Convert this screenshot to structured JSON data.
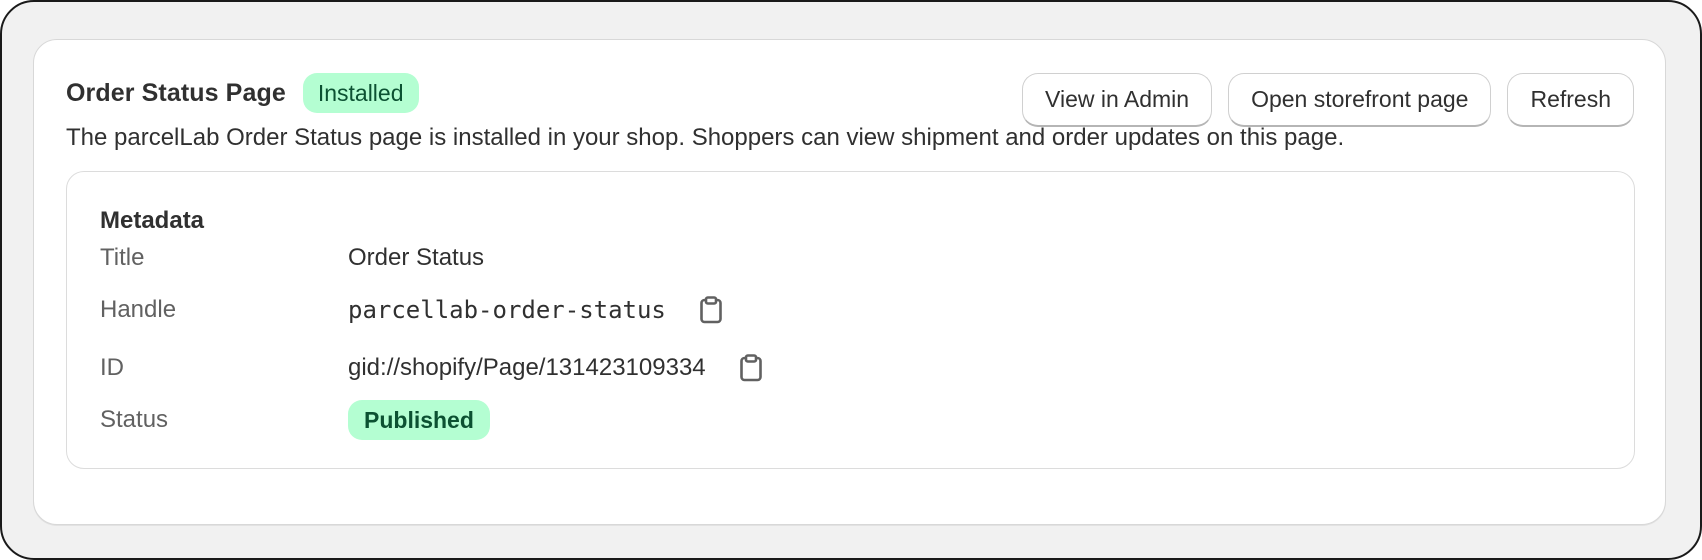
{
  "header": {
    "title": "Order Status Page",
    "badge": "Installed",
    "actions": {
      "view_admin": "View in Admin",
      "open_storefront": "Open storefront page",
      "refresh": "Refresh"
    }
  },
  "description": "The parcelLab Order Status page is installed in your shop. Shoppers can view shipment and order updates on this page.",
  "metadata": {
    "heading": "Metadata",
    "rows": [
      {
        "label": "Title",
        "value": "Order Status"
      },
      {
        "label": "Handle",
        "value": "parcellab-order-status"
      },
      {
        "label": "ID",
        "value": "gid://shopify/Page/131423109334"
      },
      {
        "label": "Status",
        "value": "Published"
      }
    ]
  },
  "icons": {
    "copy": "clipboard-icon"
  },
  "colors": {
    "badge_bg": "#b4fed2",
    "badge_text": "#0c5132",
    "text": "#303030",
    "label": "#616161"
  }
}
